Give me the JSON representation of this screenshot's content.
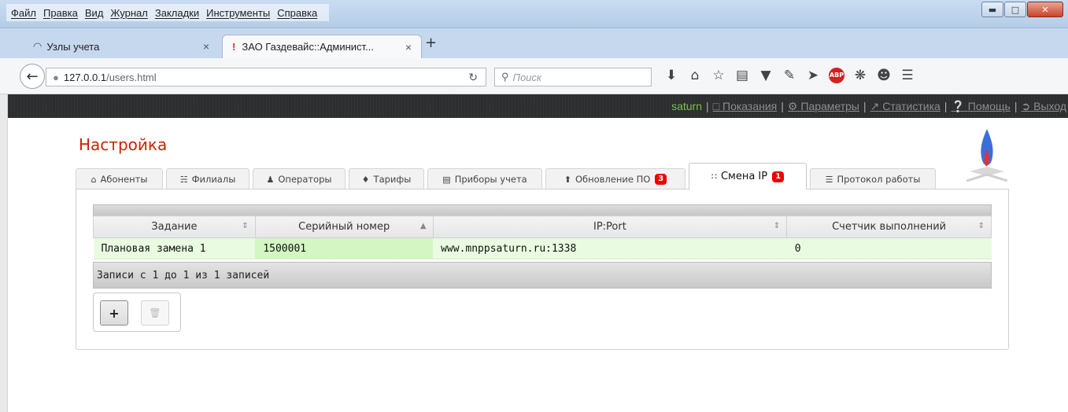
{
  "browser": {
    "menu": [
      "Файл",
      "Правка",
      "Вид",
      "Журнал",
      "Закладки",
      "Инструменты",
      "Справка"
    ],
    "tabs": [
      {
        "title": "Узлы учета"
      },
      {
        "title": "ЗАО Газдевайс::Админист..."
      }
    ],
    "url_host": "127.0.0.1",
    "url_path": "/users.html",
    "search_placeholder": "Поиск"
  },
  "app": {
    "user": "saturn",
    "nav": [
      {
        "label": "Показания",
        "icon": "monitor-icon"
      },
      {
        "label": "Параметры",
        "icon": "gear-icon"
      },
      {
        "label": "Статистика",
        "icon": "chart-icon"
      },
      {
        "label": "Помощь",
        "icon": "help-icon"
      },
      {
        "label": "Выход",
        "icon": "logout-icon"
      }
    ],
    "page_title": "Настройка",
    "tabs": [
      {
        "label": "Абоненты",
        "icon": "home-icon"
      },
      {
        "label": "Филиалы",
        "icon": "sitemap-icon"
      },
      {
        "label": "Операторы",
        "icon": "user-icon"
      },
      {
        "label": "Тарифы",
        "icon": "tag-icon"
      },
      {
        "label": "Приборы учета",
        "icon": "device-icon"
      },
      {
        "label": "Обновление ПО",
        "icon": "upload-icon",
        "badge": "3"
      },
      {
        "label": "Смена IP",
        "icon": "rss-icon",
        "badge": "1",
        "active": true
      },
      {
        "label": "Протокол работы",
        "icon": "list-icon"
      }
    ],
    "grid": {
      "columns": [
        "Задание",
        "Серийный номер",
        "IP:Port",
        "Счетчик выполнений"
      ],
      "rows": [
        [
          "Плановая замена 1",
          "1500001",
          "www.mnppsaturn.ru:1338",
          "0"
        ]
      ],
      "footer": "Записи с 1 до 1 из 1 записей"
    },
    "colors": {
      "title": "#cc2200",
      "user": "#7cc043",
      "badge": "#ee0000",
      "row": "#e9fbe0"
    }
  }
}
